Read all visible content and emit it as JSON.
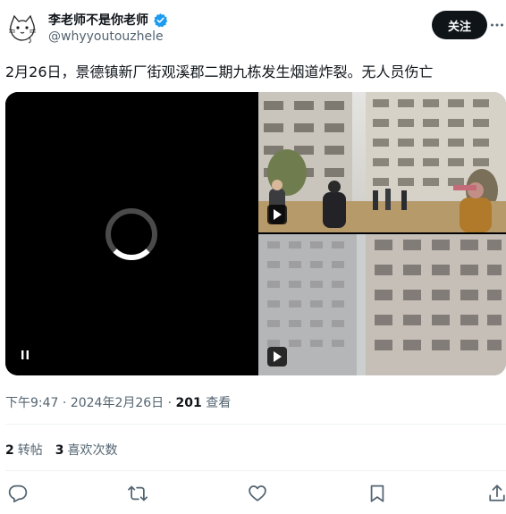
{
  "author": {
    "display_name": "李老师不是你老师",
    "handle": "@whyyoutouzhele"
  },
  "follow_button_label": "关注",
  "tweet": {
    "text": "2月26日，景德镇新厂街观溪郡二期九栋发生烟道炸裂。无人员伤亡"
  },
  "meta": {
    "time": "下午9:47",
    "separator1": " · ",
    "date": "2024年2月26日",
    "separator2": " · ",
    "views_count": "201",
    "views_label": " 查看"
  },
  "stats": {
    "retweets_count": "2",
    "retweets_label": "转帖",
    "likes_count": "3",
    "likes_label": "喜欢次数"
  },
  "colors": {
    "verified_blue": "#1d9bf0",
    "text_primary": "#0f1419",
    "text_secondary": "#536471",
    "divider": "#eff3f4"
  },
  "icons": {
    "verified": "verified-badge-icon",
    "more": "more-dots-icon",
    "spinner": "loading-spinner-icon",
    "pause": "pause-icon",
    "play": "play-icon",
    "reply": "reply-icon",
    "retweet": "retweet-icon",
    "like": "heart-icon",
    "bookmark": "bookmark-icon",
    "share": "share-icon"
  }
}
